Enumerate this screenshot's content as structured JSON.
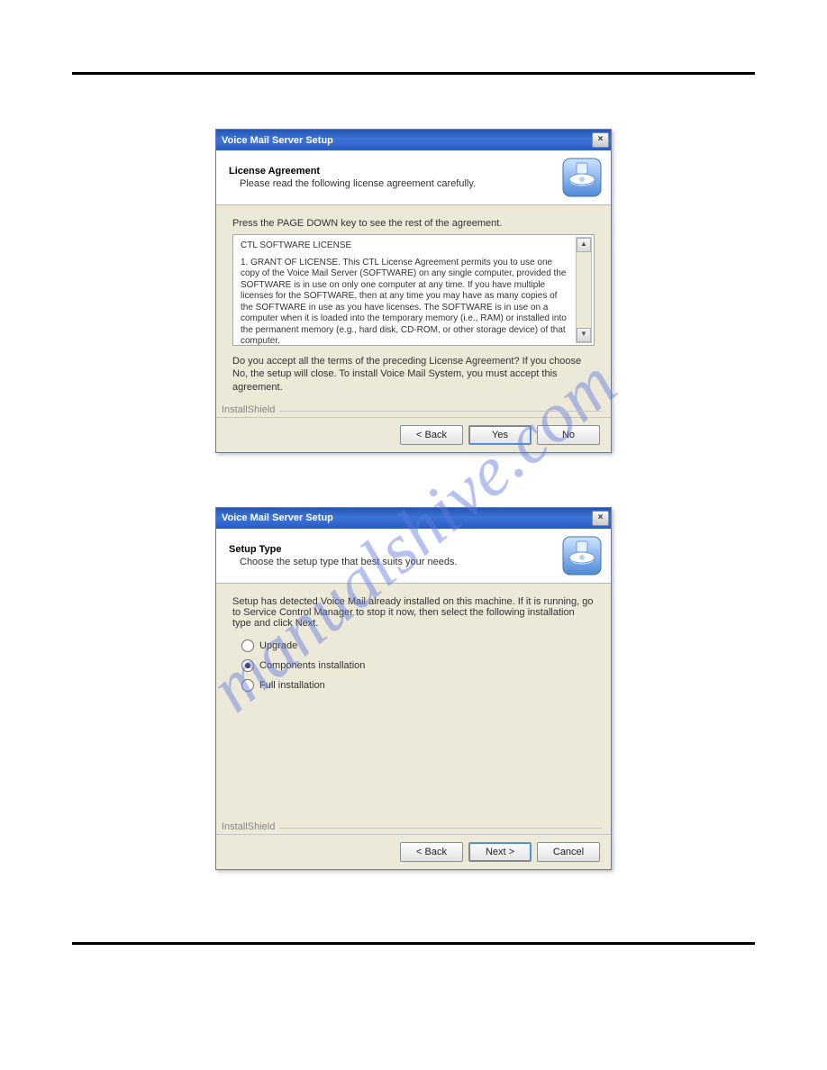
{
  "watermark": "manualshive.com",
  "dialog1": {
    "title": "Voice Mail Server Setup",
    "header_title": "License Agreement",
    "header_sub": "Please read the following license agreement carefully.",
    "instruction": "Press the PAGE DOWN key to see the rest of the agreement.",
    "license_title": "CTL SOFTWARE LICENSE",
    "license_body": "1. GRANT OF LICENSE. This CTL License Agreement permits you to use one copy of the Voice Mail Server (SOFTWARE) on any single computer, provided the SOFTWARE is in use on only one computer at any time. If you have multiple licenses for the SOFTWARE, then at any time you may have as many copies of the SOFTWARE in use as you have licenses. The SOFTWARE is in use on a computer when it is loaded into the temporary memory (i.e., RAM) or installed into the permanent memory (e.g., hard disk, CD-ROM, or other storage device) of that computer.",
    "accept_question": "Do you accept all the terms of the preceding License Agreement?  If you choose No,  the setup will close.  To install Voice Mail System, you must accept this agreement.",
    "brand": "InstallShield",
    "btn_back": "< Back",
    "btn_yes": "Yes",
    "btn_no": "No"
  },
  "dialog2": {
    "title": "Voice Mail Server Setup",
    "header_title": "Setup Type",
    "header_sub": "Choose the setup type that best suits your needs.",
    "instruction": "Setup has detected Voice Mail already installed on this machine. If it is running,  go to Service Control Manager to stop it now, then select the following installation type and click Next.",
    "options": {
      "upgrade": "Upgrade",
      "components": "Components installation",
      "full": "Full installation"
    },
    "brand": "InstallShield",
    "btn_back": "< Back",
    "btn_next": "Next >",
    "btn_cancel": "Cancel"
  }
}
